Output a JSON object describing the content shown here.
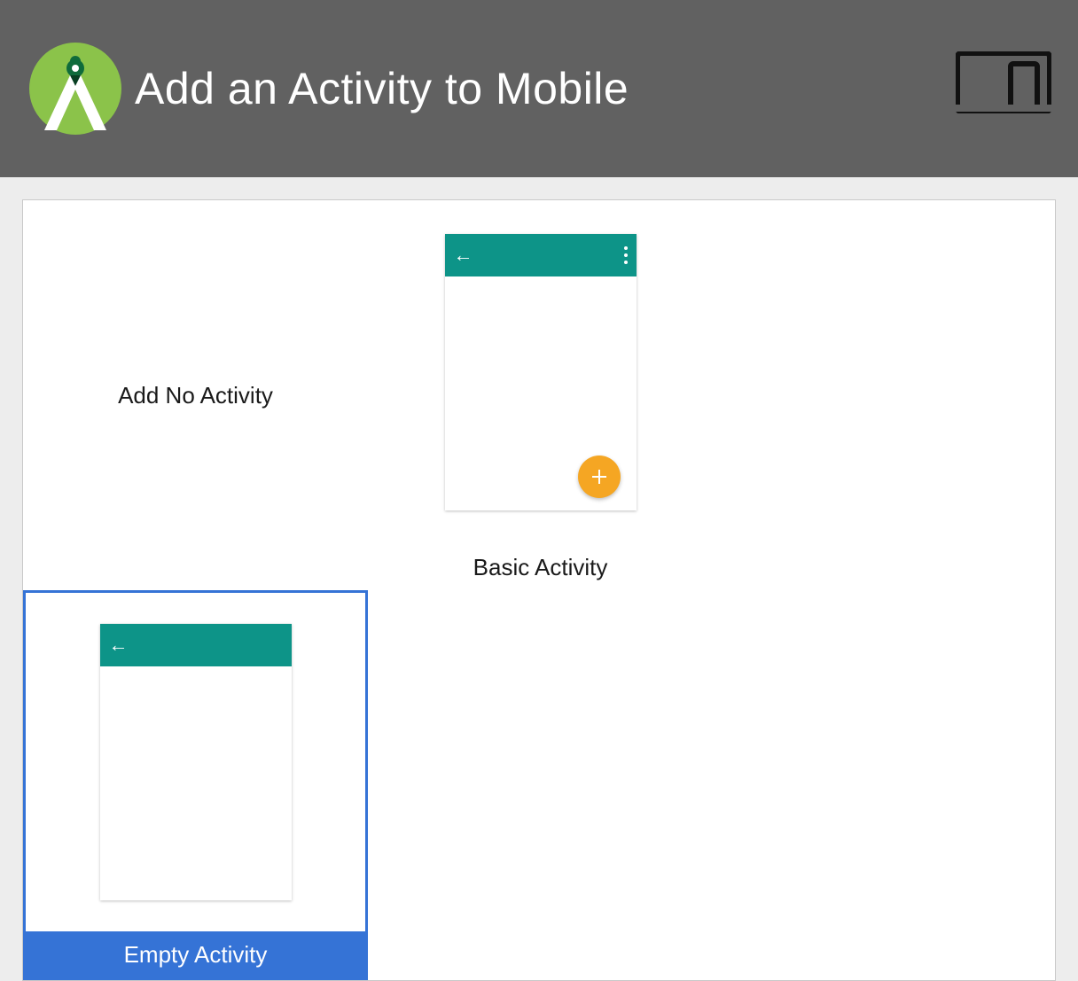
{
  "header": {
    "title": "Add an Activity to Mobile"
  },
  "tiles": [
    {
      "label": "Add No Activity",
      "type": "none",
      "selected": false
    },
    {
      "label": "Basic Activity",
      "type": "basic",
      "selected": false
    },
    {
      "label": "Empty Activity",
      "type": "empty",
      "selected": true
    }
  ],
  "icons": {
    "back_arrow": "←",
    "fab_plus": "+"
  },
  "colors": {
    "header_bg": "#616161",
    "selection": "#3573d6",
    "appbar": "#0d9488",
    "fab": "#f5a623"
  }
}
